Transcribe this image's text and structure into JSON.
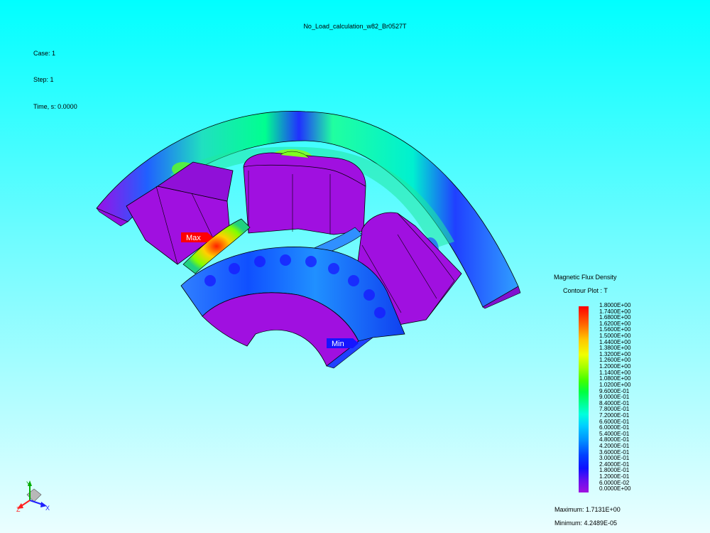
{
  "header": {
    "title": "No_Load_calculation_w82_Br0527T",
    "case": "Case: 1",
    "step": "Step: 1",
    "time": "Time, s: 0.0000"
  },
  "legend": {
    "title": "Magnetic Flux Density",
    "subtitle": "Contour Plot : T",
    "ticks": [
      "1.8000E+00",
      "1.7400E+00",
      "1.6800E+00",
      "1.6200E+00",
      "1.5600E+00",
      "1.5000E+00",
      "1.4400E+00",
      "1.3800E+00",
      "1.3200E+00",
      "1.2600E+00",
      "1.2000E+00",
      "1.1400E+00",
      "1.0800E+00",
      "1.0200E+00",
      "9.6000E-01",
      "9.0000E-01",
      "8.4000E-01",
      "7.8000E-01",
      "7.2000E-01",
      "6.6000E-01",
      "6.0000E-01",
      "5.4000E-01",
      "4.8000E-01",
      "4.2000E-01",
      "3.6000E-01",
      "3.0000E-01",
      "2.4000E-01",
      "1.8000E-01",
      "1.2000E-01",
      "6.0000E-02",
      "0.0000E+00"
    ],
    "maximum": "Maximum: 1.7131E+00",
    "minimum": "Minimum: 4.2489E-05"
  },
  "markers": {
    "max_label": "Max",
    "min_label": "Min"
  },
  "triad": {
    "x_label": "X",
    "y_label": "Y",
    "z_label": "Z"
  },
  "colors": {
    "max_marker": "#ff0000",
    "min_marker": "#1515ff",
    "material_low": "#a010e0",
    "background_top": "#00ffff"
  }
}
